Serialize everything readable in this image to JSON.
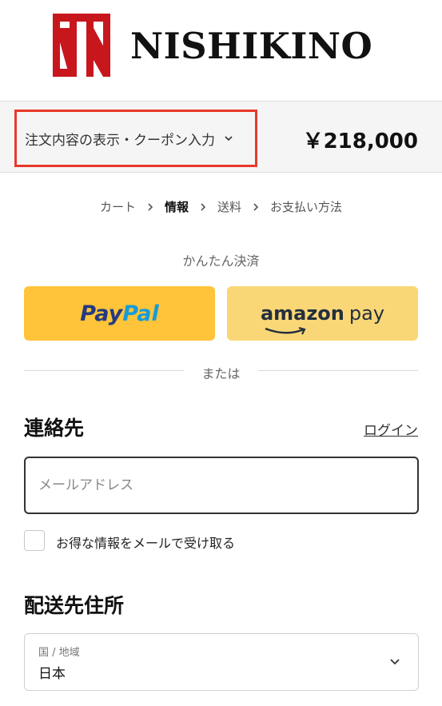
{
  "header": {
    "brand": "NISHIKINO"
  },
  "summary": {
    "toggle_label": "注文内容の表示・クーポン入力",
    "total": "￥218,000",
    "highlight_color": "#e8392b"
  },
  "breadcrumb": {
    "items": [
      "カート",
      "情報",
      "送料",
      "お支払い方法"
    ],
    "active_index": 1
  },
  "express": {
    "label": "かんたん決済",
    "paypal_part1": "Pay",
    "paypal_part2": "Pal",
    "amazon_part1": "amazon",
    "amazon_part2": "pay",
    "paypal_color": "#ffc43a",
    "amazon_color": "#fad776"
  },
  "divider": {
    "text": "または"
  },
  "contact": {
    "title": "連絡先",
    "login_link": "ログイン",
    "email_placeholder": "メールアドレス",
    "email_value": "",
    "marketing_label": "お得な情報をメールで受け取る",
    "marketing_checked": false
  },
  "shipping": {
    "title": "配送先住所",
    "country_label": "国 / 地域",
    "country_value": "日本"
  },
  "icons": {
    "summary_chevron": "chevron-down-icon",
    "breadcrumb_separator": "chevron-right-icon",
    "select_chevron": "chevron-down-icon",
    "logo": "nishikino-logo-mark"
  }
}
